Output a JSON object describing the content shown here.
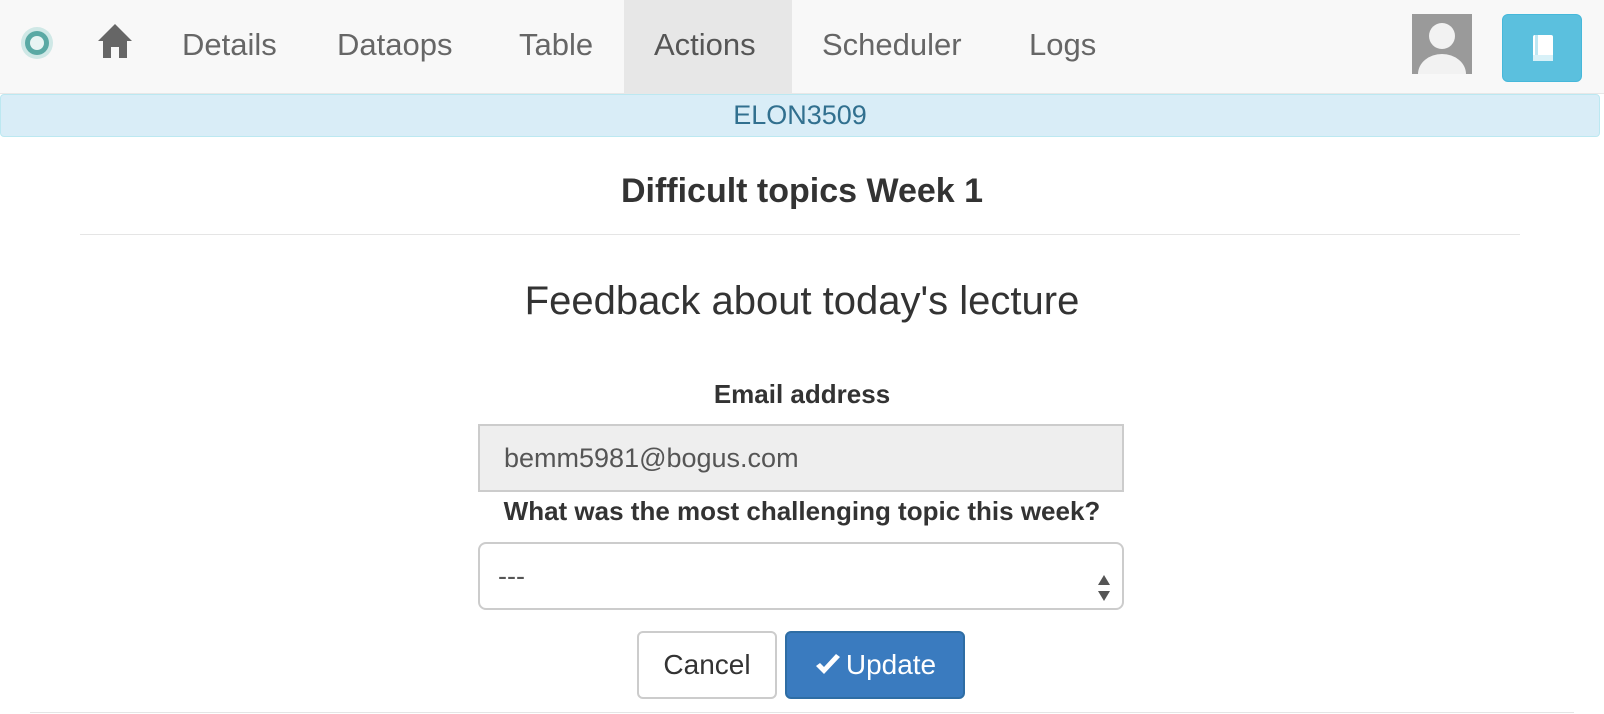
{
  "nav": {
    "items": [
      {
        "label": "Details"
      },
      {
        "label": "Dataops"
      },
      {
        "label": "Table"
      },
      {
        "label": "Actions",
        "active": true
      },
      {
        "label": "Scheduler"
      },
      {
        "label": "Logs"
      }
    ],
    "icons": {
      "logo": "ontask-logo",
      "home": "home-icon",
      "user": "user-avatar-icon",
      "book": "book-icon"
    }
  },
  "workflow": {
    "name": "ELON3509"
  },
  "page": {
    "title": "Difficult topics Week 1",
    "lead": "Feedback about today's lecture"
  },
  "form": {
    "email_label": "Email address",
    "email_value": "bemm5981@bogus.com",
    "question_label": "What was the most challenging topic this week?",
    "question_value": "---"
  },
  "buttons": {
    "cancel": "Cancel",
    "update": "Update"
  },
  "colors": {
    "accent": "#3a7bbf",
    "info_bg": "#d9edf7",
    "info_text": "#31708f",
    "book_button": "#5bc0de"
  }
}
